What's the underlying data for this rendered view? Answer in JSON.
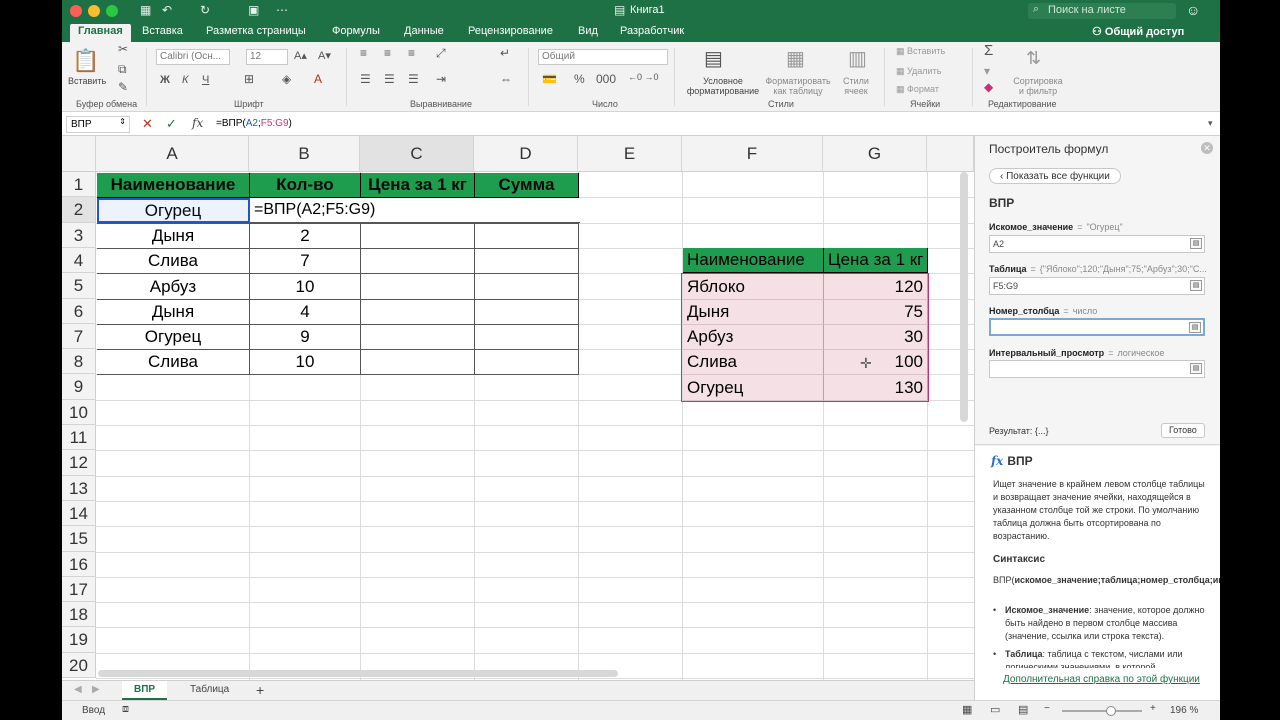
{
  "window": {
    "title": "Книга1",
    "search_placeholder": "Поиск на листе",
    "share_label": "Общий доступ"
  },
  "ribbon_tabs": [
    "Главная",
    "Вставка",
    "Разметка страницы",
    "Формулы",
    "Данные",
    "Рецензирование",
    "Вид",
    "Разработчик"
  ],
  "ribbon": {
    "paste_label": "Вставить",
    "clipboard_group": "Буфер обмена",
    "font_name": "Calibri (Осн...",
    "font_size": "12",
    "font_group": "Шрифт",
    "align_group": "Выравнивание",
    "number_format": "Общий",
    "number_group": "Число",
    "cond_format_label": "Условное форматирование",
    "format_table_label": "Форматировать как таблицу",
    "cell_styles_label": "Стили ячеек",
    "styles_group": "Стили",
    "insert_label": "Вставить",
    "delete_label": "Удалить",
    "format_label": "Формат",
    "cells_group": "Ячейки",
    "sort_filter_label": "Сортировка и фильтр",
    "editing_group": "Редактирование",
    "accent_color": "#1e7145"
  },
  "formula_bar": {
    "name_box": "ВПР",
    "prefix": "=ВПР(",
    "ref1": "A2",
    "sep": ";",
    "ref2": "F5:G9",
    "suffix": ")"
  },
  "columns": [
    "A",
    "B",
    "C",
    "D",
    "E",
    "F",
    "G"
  ],
  "rows": [
    "1",
    "2",
    "3",
    "4",
    "5",
    "6",
    "7",
    "8",
    "9",
    "10",
    "11",
    "12",
    "13",
    "14",
    "15",
    "16",
    "17",
    "18",
    "19",
    "20"
  ],
  "main_table": {
    "headers": [
      "Наименование",
      "Кол-во",
      "Цена за 1 кг",
      "Сумма"
    ],
    "rows": [
      {
        "name": "Огурец",
        "qty": ""
      },
      {
        "name": "Дыня",
        "qty": "2"
      },
      {
        "name": "Слива",
        "qty": "7"
      },
      {
        "name": "Арбуз",
        "qty": "10"
      },
      {
        "name": "Дыня",
        "qty": "4"
      },
      {
        "name": "Огурец",
        "qty": "9"
      },
      {
        "name": "Слива",
        "qty": "10"
      }
    ],
    "editing_formula": "=ВПР(A2;F5:G9)"
  },
  "price_table": {
    "headers": [
      "Наименование",
      "Цена за 1 кг"
    ],
    "rows": [
      {
        "name": "Яблоко",
        "price": "120"
      },
      {
        "name": "Дыня",
        "price": "75"
      },
      {
        "name": "Арбуз",
        "price": "30"
      },
      {
        "name": "Слива",
        "price": "100"
      },
      {
        "name": "Огурец",
        "price": "130"
      }
    ]
  },
  "sheets": [
    "ВПР",
    "Таблица"
  ],
  "status": {
    "mode": "Ввод",
    "zoom": "196 %"
  },
  "formula_builder": {
    "title": "Построитель формул",
    "show_all": "Показать все функции",
    "function": "ВПР",
    "args": [
      {
        "name": "Искомое_значение",
        "hint": "\"Огурец\"",
        "value": ""
      },
      {
        "name": "Таблица",
        "hint": "{\"Яблоко\";120;\"Дыня\";75;\"Арбуз\";30;\"С...",
        "value": ""
      },
      {
        "name": "Номер_столбца",
        "hint": "число",
        "value": ""
      },
      {
        "name": "Интервальный_просмотр",
        "hint": "логическое",
        "value": ""
      }
    ],
    "arg_values": [
      "A2",
      "F5:G9",
      "",
      ""
    ],
    "result": "Результат: {...}",
    "done": "Готово",
    "help": {
      "fn": "ВПР",
      "description": "Ищет значение в крайнем левом столбце таблицы и возвращает значение ячейки, находящейся в указанном столбце той же строки. По умолчанию таблица должна быть отсортирована по возрастанию.",
      "syntax_title": "Синтаксис",
      "syntax_fn": "ВПР(",
      "syntax_args": "искомое_значение;таблица;номер_столбца;интервальный_просмотр",
      "syntax_close": ")",
      "bullet1_term": "Искомое_значение",
      "bullet1_text": ": значение, которое должно быть найдено в первом столбце массива (значение, ссылка или строка текста).",
      "bullet2_term": "Таблица",
      "bullet2_text": ": таблица с текстом, числами или логическими значениями, в которой",
      "more_link": "Дополнительная справка по этой функции"
    }
  }
}
